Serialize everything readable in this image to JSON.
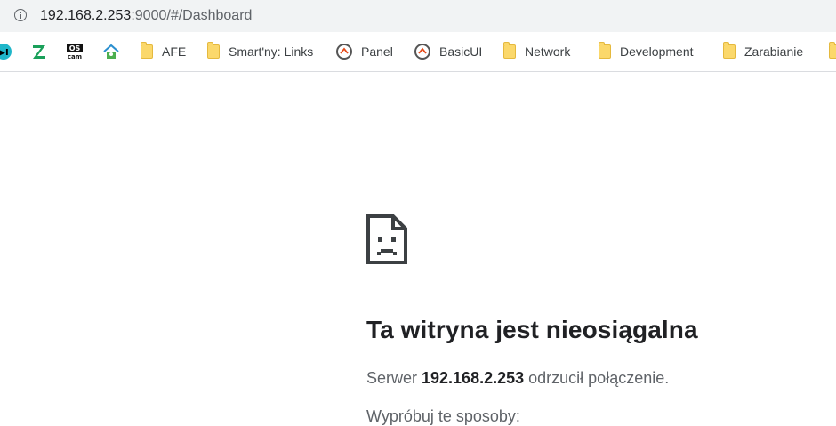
{
  "browser": {
    "url_host": "192.168.2.253",
    "url_rest": ":9000/#/Dashboard"
  },
  "bookmarks": [
    {
      "label": "AFE",
      "icon": "folder-icon"
    },
    {
      "label": "Smart'ny: Links",
      "icon": "folder-icon"
    },
    {
      "label": "Panel",
      "icon": "openhab-icon"
    },
    {
      "label": "BasicUI",
      "icon": "openhab-icon"
    },
    {
      "label": "Network",
      "icon": "folder-icon"
    },
    {
      "label": "Development",
      "icon": "folder-icon"
    },
    {
      "label": "Zarabianie",
      "icon": "folder-icon"
    }
  ],
  "error": {
    "title": "Ta witryna jest nieosiągalna",
    "msg_prefix": "Serwer ",
    "msg_host": "192.168.2.253",
    "msg_suffix": " odrzucił połączenie.",
    "more": "Wypróbuj te sposoby:"
  },
  "colors": {
    "toolbar_bg": "#f1f3f4",
    "folder": "#fbd86b",
    "openhab": "#e64a19"
  }
}
